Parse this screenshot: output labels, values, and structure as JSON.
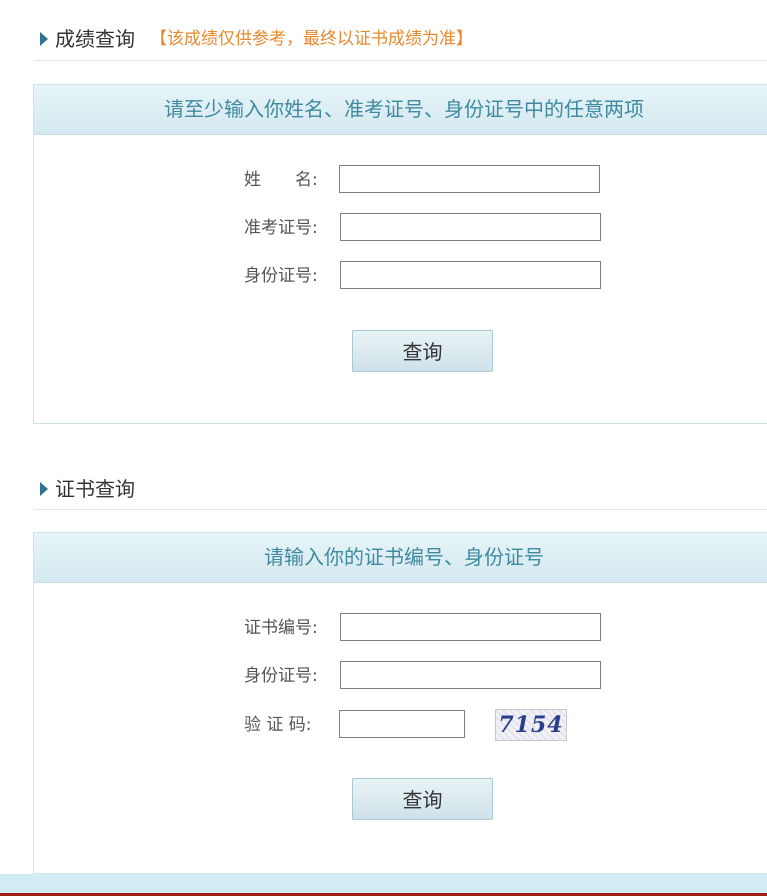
{
  "score_section": {
    "title": "成绩查询",
    "note": "【该成绩仅供参考，最终以证书成绩为准】",
    "panel_heading": "请至少输入你姓名、准考证号、身份证号中的任意两项",
    "fields": {
      "name_label": "姓　　名:",
      "exam_no_label": "准考证号:",
      "id_no_label": "身份证号:"
    },
    "submit_label": "查询"
  },
  "cert_section": {
    "title": "证书查询",
    "panel_heading": "请输入你的证书编号、身份证号",
    "fields": {
      "cert_no_label": "证书编号:",
      "id_no_label": "身份证号:",
      "captcha_label": "验 证 码:"
    },
    "captcha_text": "7154",
    "submit_label": "查询"
  },
  "icons": {
    "section_marker": "triangle-right-icon"
  },
  "colors": {
    "accent": "#2f7393",
    "heading_text": "#3f8aa0",
    "note_text": "#e7892e",
    "panel_head_bg": "#d4e9f0",
    "bottom_rule": "#a61d1d"
  }
}
